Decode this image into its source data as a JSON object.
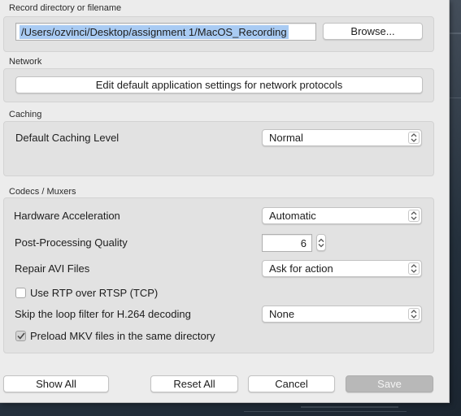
{
  "record": {
    "section_title": "Record directory or filename",
    "path_value": "/Users/ozvinci/Desktop/assignment 1/MacOS_Recording",
    "browse_label": "Browse..."
  },
  "network": {
    "section_title": "Network",
    "edit_button_label": "Edit default application settings for network protocols"
  },
  "caching": {
    "section_title": "Caching",
    "level_label": "Default Caching Level",
    "level_value": "Normal"
  },
  "codecs": {
    "section_title": "Codecs / Muxers",
    "hw_accel_label": "Hardware Acceleration",
    "hw_accel_value": "Automatic",
    "pp_quality_label": "Post-Processing Quality",
    "pp_quality_value": "6",
    "repair_avi_label": "Repair AVI Files",
    "repair_avi_value": "Ask for action",
    "rtp_label": "Use RTP over RTSP (TCP)",
    "rtp_checked": false,
    "loop_filter_label": "Skip the loop filter for H.264 decoding",
    "loop_filter_value": "None",
    "preload_mkv_label": "Preload MKV files in the same directory",
    "preload_mkv_checked": true
  },
  "footer": {
    "show_all_label": "Show All",
    "reset_all_label": "Reset All",
    "cancel_label": "Cancel",
    "save_label": "Save"
  },
  "colors": {
    "selection_highlight": "#a9cbf3",
    "dialog_background": "#ececec",
    "group_background": "#e2e2e2",
    "disabled_button": "#b8b8b8"
  }
}
